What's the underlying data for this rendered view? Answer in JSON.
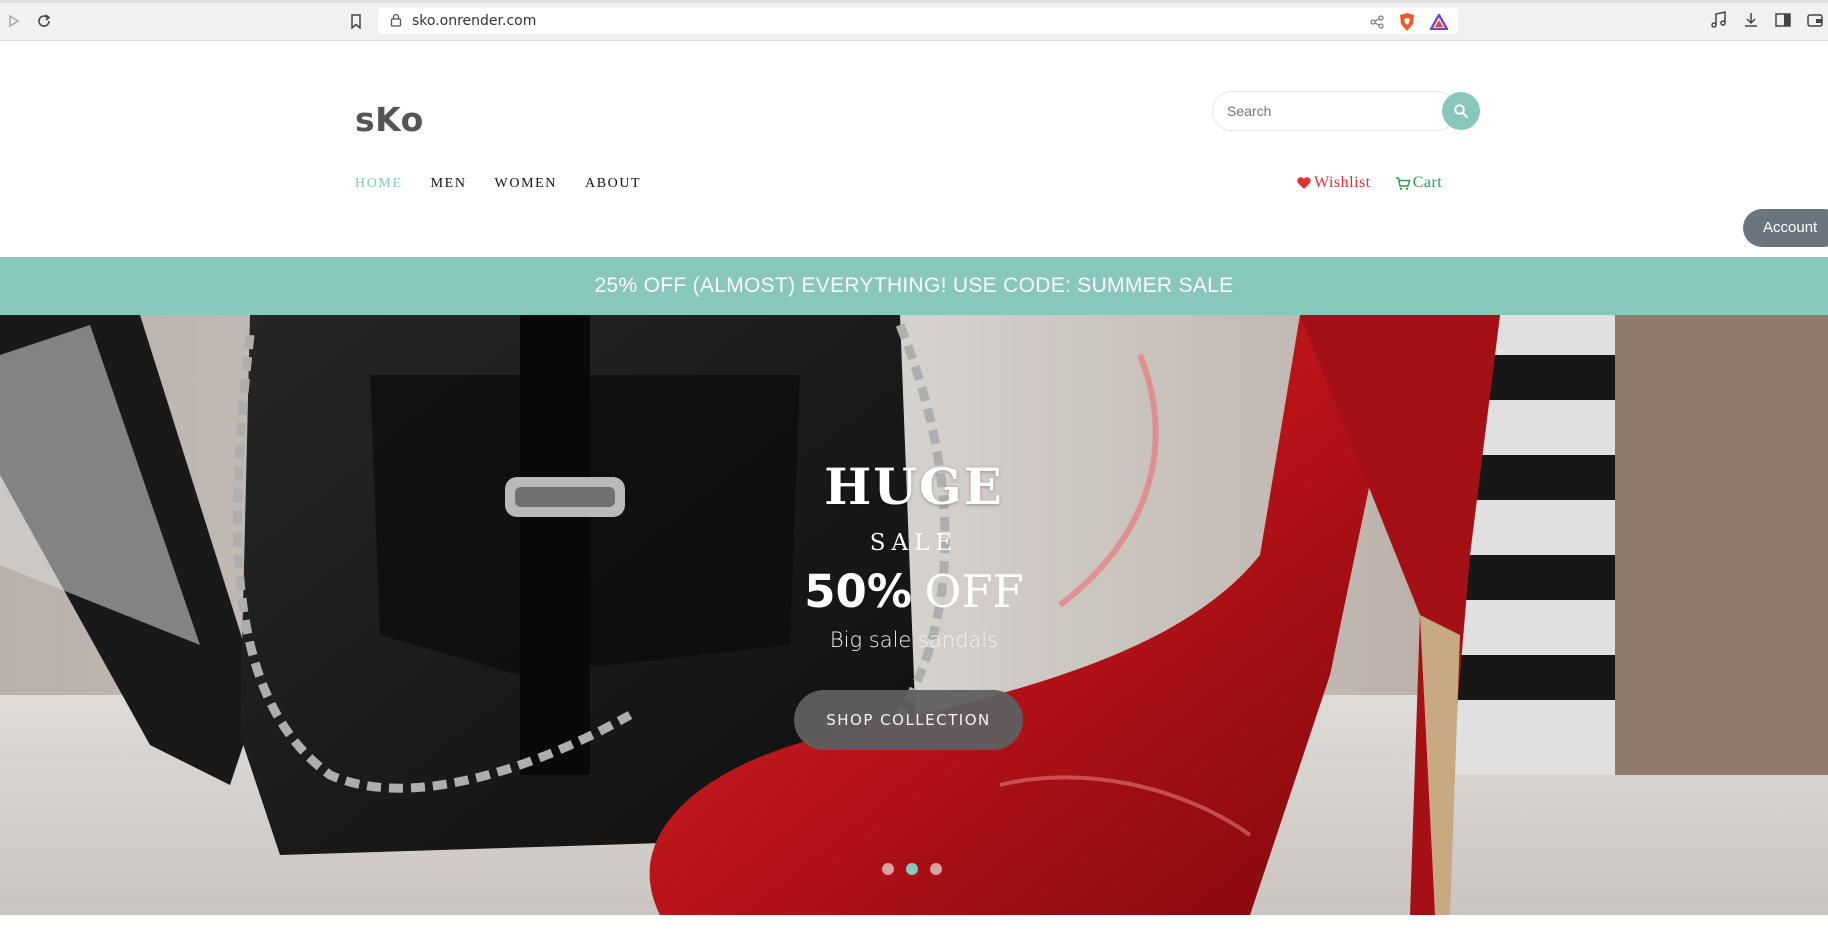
{
  "browser": {
    "url": "sko.onrender.com"
  },
  "header": {
    "logo": "sKo",
    "search_placeholder": "Search",
    "nav": [
      {
        "label": "HOME",
        "active": true
      },
      {
        "label": "MEN",
        "active": false
      },
      {
        "label": "WOMEN",
        "active": false
      },
      {
        "label": "ABOUT",
        "active": false
      }
    ],
    "wishlist_label": "Wishlist",
    "cart_label": "Cart",
    "account_label": "Account"
  },
  "promo": {
    "text": "25% OFF (ALMOST) EVERYTHING! USE CODE: SUMMER SALE"
  },
  "hero": {
    "title": "HUGE",
    "subtitle": "SALE",
    "discount_pct": "50%",
    "discount_off": "OFF",
    "tagline": "Big sale sandals",
    "button_label": "SHOP COLLECTION",
    "slides": 3,
    "active_slide": 2
  },
  "colors": {
    "accent": "#88c8bc",
    "wishlist": "#e03030",
    "cart": "#2a9a4a",
    "account_bg": "#6c757d"
  }
}
